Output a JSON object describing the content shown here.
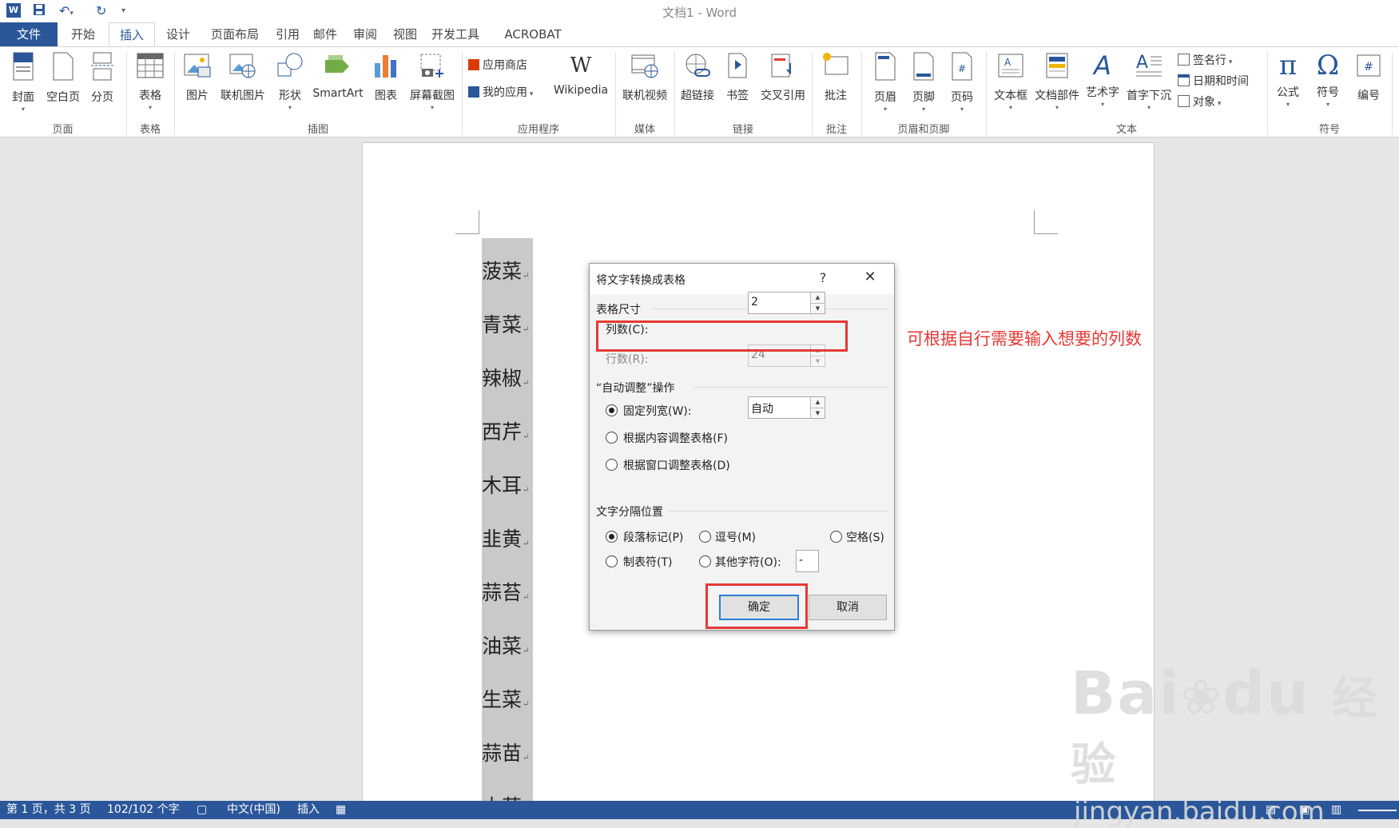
{
  "window": {
    "title": "文档1 - Word"
  },
  "quick_access": {
    "save_icon": "save-icon",
    "undo_icon": "undo-icon",
    "redo_icon": "redo-icon",
    "customize": "▾"
  },
  "tabs": [
    "文件",
    "开始",
    "插入",
    "设计",
    "页面布局",
    "引用",
    "邮件",
    "审阅",
    "视图",
    "开发工具",
    "ACROBAT"
  ],
  "active_tab": "插入",
  "ribbon": {
    "buttons": {
      "cover": "封面",
      "blank_page": "空白页",
      "page_break": "分页",
      "table": "表格",
      "picture": "图片",
      "online_picture": "联机图片",
      "shapes": "形状",
      "smartart": "SmartArt",
      "chart": "图表",
      "screenshot": "屏幕截图",
      "store": "应用商店",
      "my_apps": "我的应用",
      "wikipedia": "Wikipedia",
      "online_video": "联机视频",
      "hyperlink": "超链接",
      "bookmark": "书签",
      "cross_ref": "交叉引用",
      "comment": "批注",
      "header": "页眉",
      "footer": "页脚",
      "page_number": "页码",
      "textbox": "文本框",
      "quick_parts": "文档部件",
      "wordart": "艺术字",
      "dropcap": "首字下沉",
      "signature_line": "签名行",
      "datetime": "日期和时间",
      "object": "对象",
      "equation": "公式",
      "symbol": "符号",
      "numbering": "编号"
    },
    "groups": {
      "pages": "页面",
      "tables": "表格",
      "illustrations": "插图",
      "apps": "应用程序",
      "media": "媒体",
      "links": "链接",
      "comments": "批注",
      "header_footer": "页眉和页脚",
      "text": "文本",
      "symbols": "符号"
    }
  },
  "document": {
    "lines": [
      "菠菜",
      "青菜",
      "辣椒",
      "西芹",
      "木耳",
      "韭黄",
      "蒜苔",
      "油菜",
      "生菜",
      "蒜苗",
      "大蒜"
    ],
    "para_mark": "↵"
  },
  "dialog": {
    "title": "将文字转换成表格",
    "help": "?",
    "close": "✕",
    "section_size": "表格尺寸",
    "columns_label": "列数(C):",
    "columns_value": "2",
    "rows_label": "行数(R):",
    "rows_value": "24",
    "section_autofit": "“自动调整”操作",
    "fixed_width_label": "固定列宽(W):",
    "fixed_width_value": "自动",
    "autofit_content": "根据内容调整表格(F)",
    "autofit_window": "根据窗口调整表格(D)",
    "section_separator": "文字分隔位置",
    "sep_paragraph": "段落标记(P)",
    "sep_comma": "逗号(M)",
    "sep_space": "空格(S)",
    "sep_tab": "制表符(T)",
    "sep_other": "其他字符(O):",
    "sep_other_value": "-",
    "ok": "确定",
    "cancel": "取消"
  },
  "annotation": "可根据自行需要输入想要的列数",
  "status_bar": {
    "page": "第 1 页，共 3 页",
    "words": "102/102 个字",
    "language": "中文(中国)",
    "mode": "插入"
  },
  "watermark": {
    "brand": "Bai",
    "brand2": "du",
    "cn": "经验",
    "url": "jingyan.baidu.com"
  },
  "colors": {
    "accent": "#2b579a",
    "annotation_red": "#e53935"
  }
}
